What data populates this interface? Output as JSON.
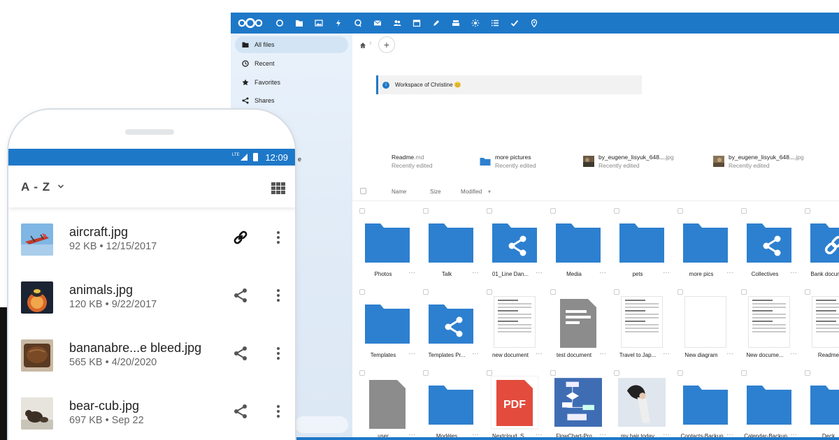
{
  "colors": {
    "accent": "#1e78c8",
    "folder": "#2d80cf",
    "grey_file": "#8c8c8c",
    "pdf": "#e34b3c"
  },
  "desktop": {
    "topbar_icons": [
      "dashboard-icon",
      "files-icon",
      "photos-icon",
      "activity-icon",
      "talk-icon",
      "mail-icon",
      "contacts-icon",
      "calendar-icon",
      "notes-icon",
      "deck-icon",
      "weather-icon",
      "tasks-icon",
      "checkmark-icon",
      "maps-icon"
    ],
    "sidebar": {
      "items": [
        {
          "label": "All files",
          "icon": "folder-icon"
        },
        {
          "label": "Recent",
          "icon": "clock-icon"
        },
        {
          "label": "Favorites",
          "icon": "star-icon"
        },
        {
          "label": "Shares",
          "icon": "share-icon"
        }
      ],
      "partial_label": "e"
    },
    "add_label": "+",
    "workspace": {
      "info": "i",
      "text": "Workspace of Christine 😊"
    },
    "recent": [
      {
        "name": "Readme",
        "ext": ".md",
        "sub": "Recently edited",
        "icon": "text-file-icon"
      },
      {
        "name": "more pictures",
        "ext": "",
        "sub": "Recently edited",
        "icon": "folder-icon"
      },
      {
        "name": "by_eugene_lisyuk_648....",
        "ext": "jpg",
        "sub": "Recently edited",
        "icon": "photo-thumbnail"
      },
      {
        "name": "by_eugene_lisyuk_648....",
        "ext": "jpg",
        "sub": "Recently edited",
        "icon": "photo-thumbnail"
      }
    ],
    "columns": {
      "name": "Name",
      "size": "Size",
      "modified": "Modified",
      "sort_arrow": "▾"
    },
    "more_label": "···",
    "rows": [
      [
        {
          "name": "Photos",
          "type": "folder"
        },
        {
          "name": "Talk",
          "type": "folder"
        },
        {
          "name": "01_Line Dan...",
          "type": "shared-folder"
        },
        {
          "name": "Media",
          "type": "folder"
        },
        {
          "name": "pets",
          "type": "folder"
        },
        {
          "name": "more pics",
          "type": "folder"
        },
        {
          "name": "Collectives",
          "type": "shared-folder"
        },
        {
          "name": "Bank docum...",
          "type": "link-folder"
        }
      ],
      [
        {
          "name": "Templates",
          "type": "folder"
        },
        {
          "name": "Templates Pr...",
          "type": "shared-folder"
        },
        {
          "name": "new document",
          "type": "document"
        },
        {
          "name": "test document",
          "type": "grey-doc"
        },
        {
          "name": "Travel to Jap...",
          "type": "document"
        },
        {
          "name": "New diagram",
          "type": "blank"
        },
        {
          "name": "New docume...",
          "type": "document"
        },
        {
          "name": "Readme",
          "type": "document"
        }
      ],
      [
        {
          "name": "user",
          "type": "grey-file"
        },
        {
          "name": "Modèles",
          "type": "folder"
        },
        {
          "name": "Nextcloud_S...",
          "type": "pdf",
          "badge": "PDF"
        },
        {
          "name": "FlowChart-Pro",
          "type": "flowchart"
        },
        {
          "name": "my hair today",
          "type": "photo"
        },
        {
          "name": ".Contacts-Backup",
          "type": "folder"
        },
        {
          "name": ".Calendar-Backup",
          "type": "folder"
        },
        {
          "name": "Deck",
          "type": "folder"
        }
      ]
    ]
  },
  "phone": {
    "status": {
      "network": "LTE",
      "time": "12:09"
    },
    "sort_label": "A - Z",
    "files": [
      {
        "name": "aircraft.jpg",
        "meta": "92 KB • 12/15/2017",
        "action": "link-icon",
        "thumb": "aircraft-thumbnail"
      },
      {
        "name": "animals.jpg",
        "meta": "120 KB • 9/22/2017",
        "action": "share-icon",
        "thumb": "animals-thumbnail"
      },
      {
        "name": "bananabre...e bleed.jpg",
        "meta": "565 KB • 4/20/2020",
        "action": "share-icon",
        "thumb": "bread-thumbnail"
      },
      {
        "name": "bear-cub.jpg",
        "meta": "697 KB • Sep 22",
        "action": "share-icon",
        "thumb": "bear-thumbnail"
      }
    ]
  }
}
